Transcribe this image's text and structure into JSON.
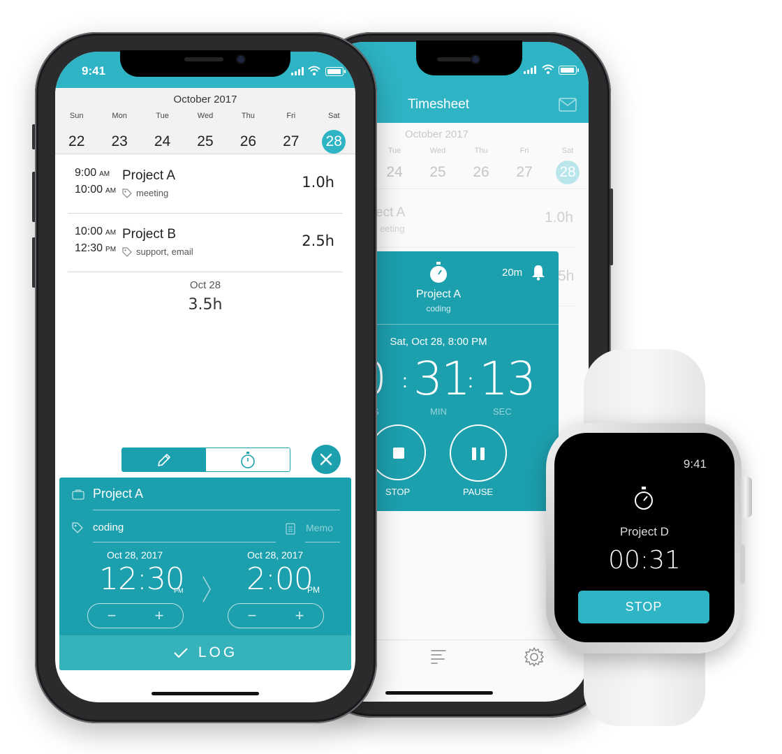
{
  "phone_left": {
    "status_time": "9:41",
    "calendar": {
      "month": "October 2017",
      "days": [
        {
          "name": "Sun",
          "num": "22"
        },
        {
          "name": "Mon",
          "num": "23"
        },
        {
          "name": "Tue",
          "num": "24"
        },
        {
          "name": "Wed",
          "num": "25"
        },
        {
          "name": "Thu",
          "num": "26"
        },
        {
          "name": "Fri",
          "num": "27"
        },
        {
          "name": "Sat",
          "num": "28"
        }
      ],
      "selected": "28"
    },
    "entries": [
      {
        "start": "9:00",
        "start_ap": "AM",
        "end": "10:00",
        "end_ap": "AM",
        "project": "Project A",
        "tags": "meeting",
        "hours": "1.0h"
      },
      {
        "start": "10:00",
        "start_ap": "AM",
        "end": "12:30",
        "end_ap": "PM",
        "project": "Project B",
        "tags": "support, email",
        "hours": "2.5h"
      }
    ],
    "summary": {
      "date": "Oct 28",
      "total": "3.5h"
    },
    "log_panel": {
      "project": "Project A",
      "tag": "coding",
      "memo_placeholder": "Memo",
      "start": {
        "date": "Oct 28, 2017",
        "time": "12:30",
        "ampm": "PM"
      },
      "end": {
        "date": "Oct 28, 2017",
        "time": "2:00",
        "ampm": "PM"
      },
      "minus": "−",
      "plus": "+",
      "log_label": "LOG"
    }
  },
  "phone_right": {
    "title": "Timesheet",
    "calendar": {
      "month": "October 2017",
      "days": [
        {
          "name": "Tue",
          "num": "24"
        },
        {
          "name": "Wed",
          "num": "25"
        },
        {
          "name": "Thu",
          "num": "26"
        },
        {
          "name": "Fri",
          "num": "27"
        },
        {
          "name": "Sat",
          "num": "28"
        }
      ]
    },
    "bg_entry": {
      "project": "ect A",
      "tags": "eeting",
      "hours": "1.0h",
      "hours2": "5h"
    },
    "timer": {
      "reminder": "20m",
      "project": "Project A",
      "tag": "coding",
      "started": "Sat, Oct 28, 8:00 PM",
      "hours_partial": "0",
      "minutes": "31",
      "seconds": "13",
      "hrs_label_partial": "S",
      "min_label": "MIN",
      "sec_label": "SEC",
      "stop_label": "STOP",
      "pause_label": "PAUSE"
    }
  },
  "watch": {
    "time": "9:41",
    "project": "Project D",
    "elapsed": "00:31",
    "stop_label": "STOP"
  },
  "colors": {
    "accent": "#2eb4c4",
    "accent_dark": "#1da0ae"
  }
}
